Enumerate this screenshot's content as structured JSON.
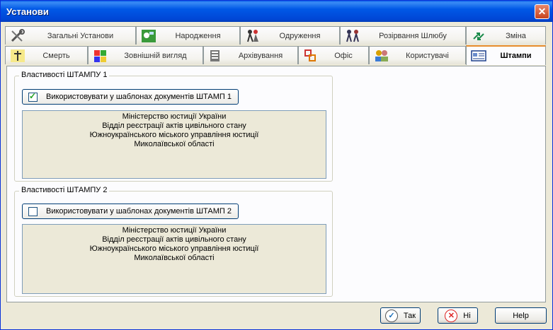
{
  "window": {
    "title": "Установи",
    "close_icon": "close-icon"
  },
  "tabs_row1": [
    {
      "label": "Загальні Установи",
      "icon": "tools-icon"
    },
    {
      "label": "Народження",
      "icon": "birth-icon"
    },
    {
      "label": "Одруження",
      "icon": "wedding-icon"
    },
    {
      "label": "Розірвання Шлюбу",
      "icon": "divorce-icon"
    },
    {
      "label": "Зміна",
      "icon": "change-arrows-icon"
    }
  ],
  "tabs_row2": [
    {
      "label": "Смерть",
      "icon": "cross-icon"
    },
    {
      "label": "Зовнішній вигляд",
      "icon": "appearance-icon"
    },
    {
      "label": "Архівування",
      "icon": "archive-icon"
    },
    {
      "label": "Офіс",
      "icon": "office-icon"
    },
    {
      "label": "Користувачі",
      "icon": "users-icon"
    },
    {
      "label": "Штампи",
      "icon": "stamp-card-icon",
      "active": true
    }
  ],
  "stamp1": {
    "legend": "Властивості ШТАМПУ 1",
    "checkbox_label": "Використовувати у шаблонах документів ШТАМП 1",
    "checked": true,
    "lines": [
      "Міністерство юстиції України",
      "Відділ реєстрації актів цивільного стану",
      "Южноукраїнського міського управління юстиції",
      "Миколаївської області"
    ]
  },
  "stamp2": {
    "legend": "Властивості ШТАМПУ 2",
    "checkbox_label": "Використовувати у шаблонах документів ШТАМП 2",
    "checked": false,
    "lines": [
      "Міністерство юстиції України",
      "Відділ реєстрації актів цивільного стану",
      "Южноукраїнського міського управління юстиції",
      "Миколаївської області"
    ]
  },
  "buttons": {
    "ok": "Так",
    "no": "Ні",
    "help": "Help"
  },
  "colors": {
    "title_blue": "#0058e6",
    "active_tab_accent": "#e68b2c",
    "face": "#ece9d8"
  }
}
